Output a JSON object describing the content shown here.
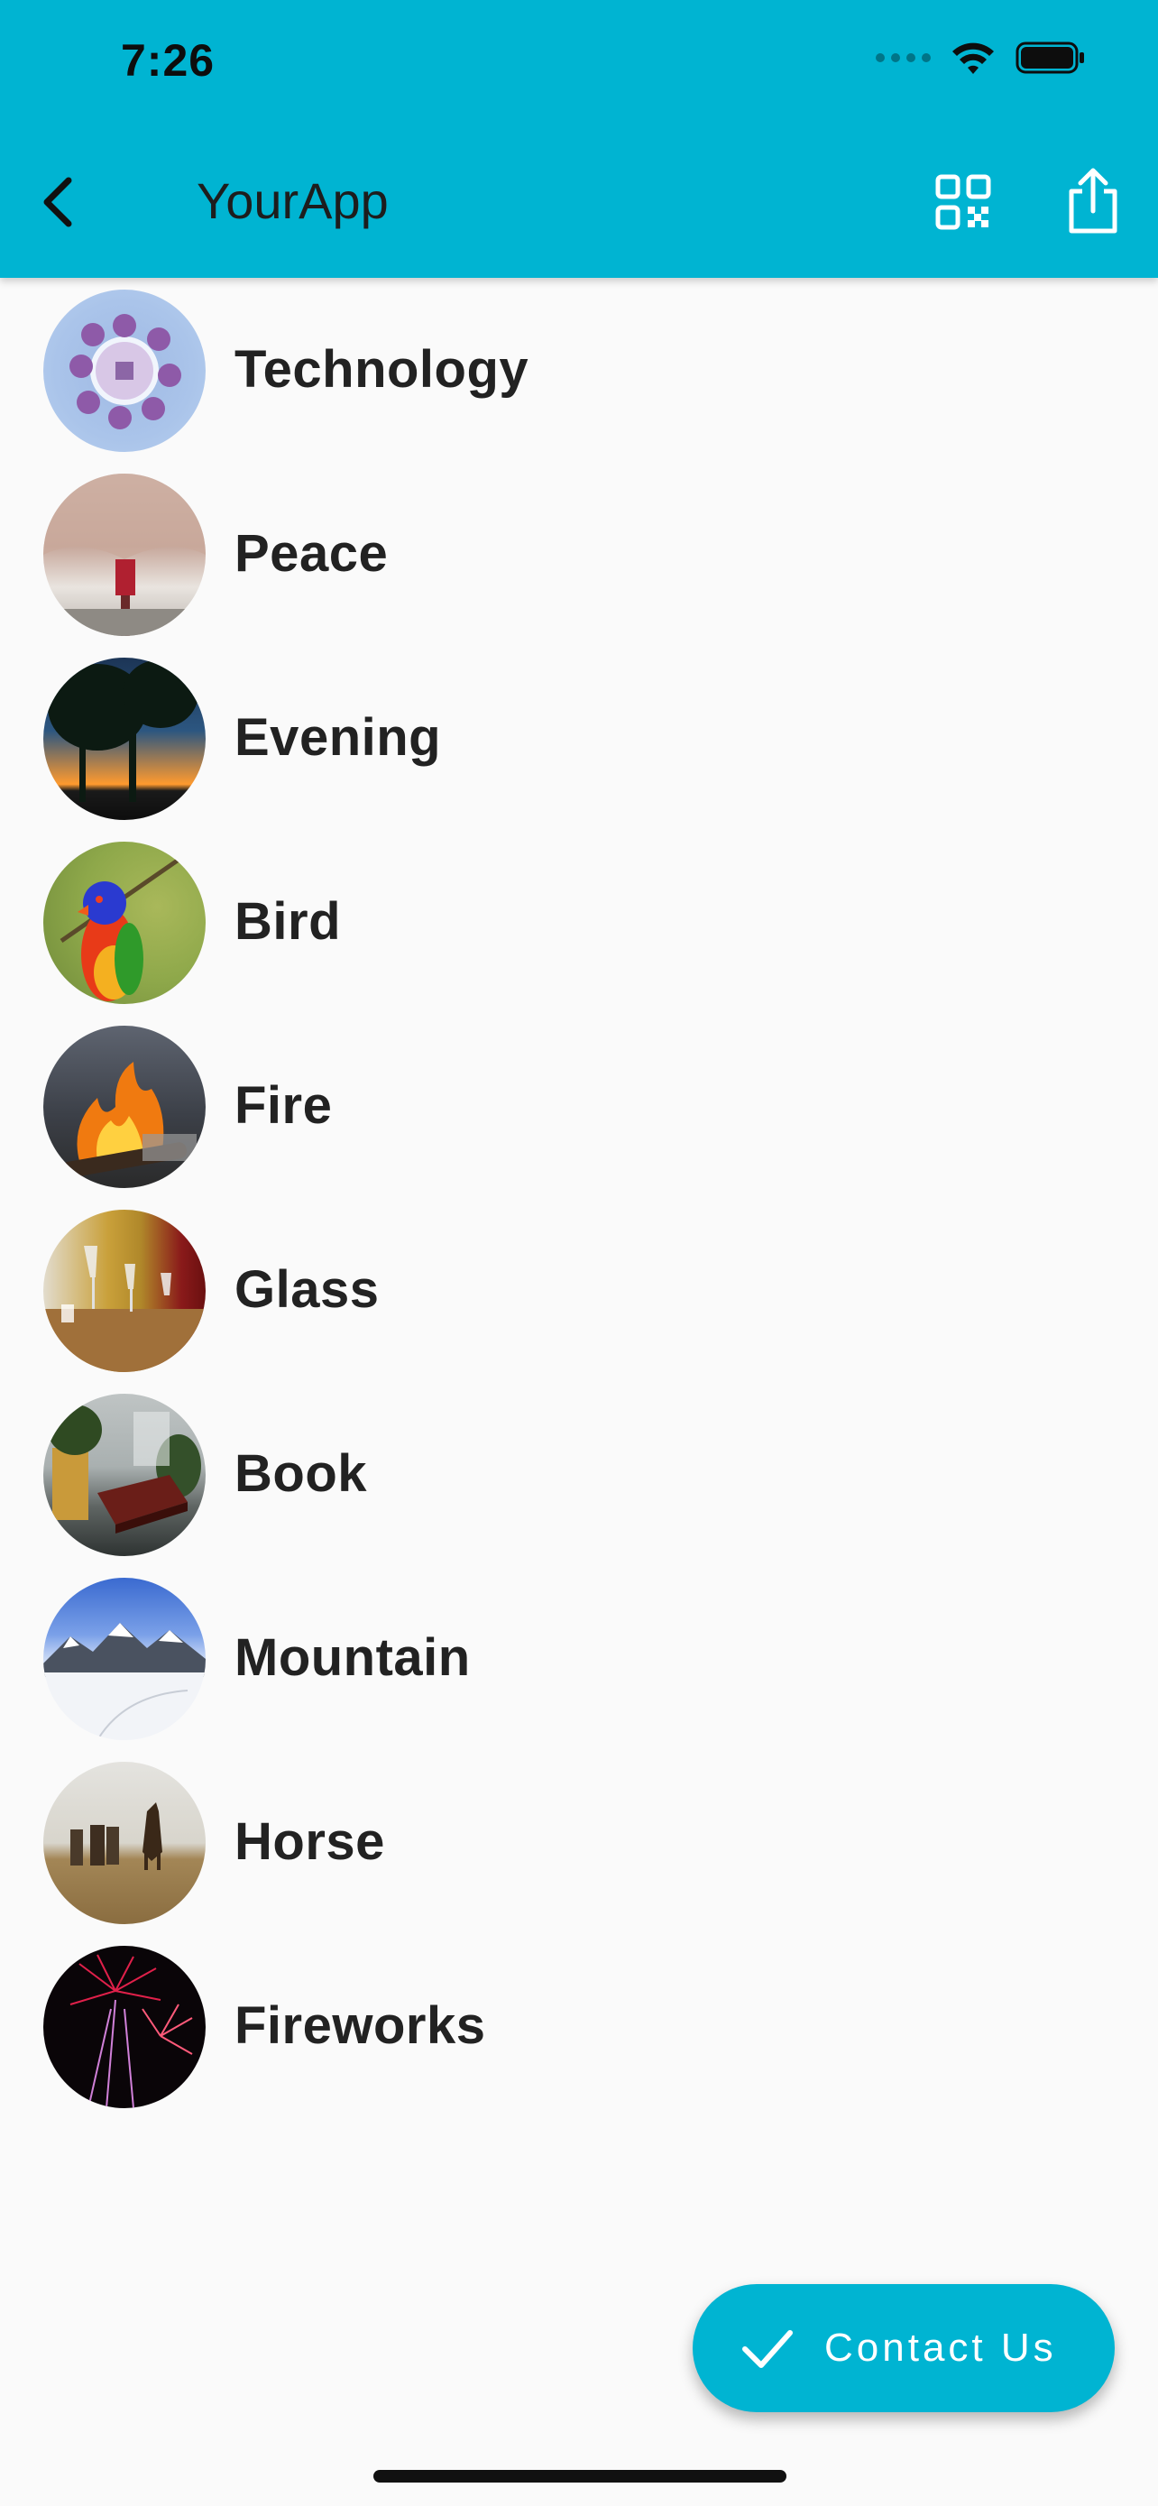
{
  "status_bar": {
    "time": "7:26"
  },
  "app_bar": {
    "title": "YourApp",
    "back_icon": "chevron-left-icon",
    "qr_icon": "qr-code-icon",
    "share_icon": "share-icon"
  },
  "list": {
    "items": [
      {
        "label": "Technology"
      },
      {
        "label": "Peace"
      },
      {
        "label": "Evening"
      },
      {
        "label": "Bird"
      },
      {
        "label": "Fire"
      },
      {
        "label": "Glass"
      },
      {
        "label": "Book"
      },
      {
        "label": "Mountain"
      },
      {
        "label": "Horse"
      },
      {
        "label": "Fireworks"
      }
    ]
  },
  "fab": {
    "label": "Contact Us",
    "icon": "check-icon"
  },
  "colors": {
    "primary": "#00b4d2",
    "background": "#fafafa",
    "text": "#222222"
  }
}
